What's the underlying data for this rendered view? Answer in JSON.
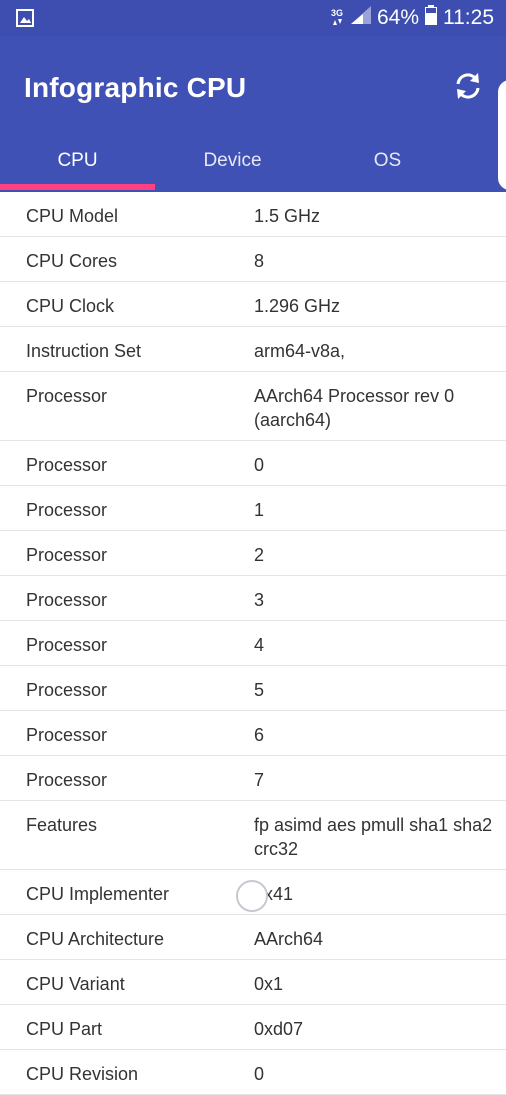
{
  "status_bar": {
    "network_type": "3G",
    "battery": "64%",
    "time": "11:25"
  },
  "app_bar": {
    "title": "Infographic CPU",
    "refresh_icon": "refresh-icon"
  },
  "tabs": [
    {
      "label": "CPU",
      "active": true
    },
    {
      "label": "Device",
      "active": false
    },
    {
      "label": "OS",
      "active": false
    }
  ],
  "rows": [
    {
      "label": "CPU Model",
      "value": "1.5 GHz"
    },
    {
      "label": "CPU Cores",
      "value": "8"
    },
    {
      "label": "CPU Clock",
      "value": "1.296 GHz"
    },
    {
      "label": "Instruction Set",
      "value": "arm64-v8a,"
    },
    {
      "label": "Processor",
      "value": "AArch64 Processor rev 0 (aarch64)"
    },
    {
      "label": "Processor",
      "value": "0"
    },
    {
      "label": "Processor",
      "value": "1"
    },
    {
      "label": "Processor",
      "value": "2"
    },
    {
      "label": "Processor",
      "value": "3"
    },
    {
      "label": "Processor",
      "value": "4"
    },
    {
      "label": "Processor",
      "value": "5"
    },
    {
      "label": "Processor",
      "value": "6"
    },
    {
      "label": "Processor",
      "value": "7"
    },
    {
      "label": "Features",
      "value": "fp asimd aes pmull sha1 sha2 crc32"
    },
    {
      "label": "CPU Implementer",
      "value": "0x41"
    },
    {
      "label": "CPU Architecture",
      "value": "AArch64"
    },
    {
      "label": "CPU Variant",
      "value": "0x1"
    },
    {
      "label": "CPU Part",
      "value": "0xd07"
    },
    {
      "label": "CPU Revision",
      "value": "0"
    }
  ],
  "colors": {
    "primary": "#3f51b5",
    "primary_dark": "#3e4eb0",
    "accent": "#ff4081"
  }
}
